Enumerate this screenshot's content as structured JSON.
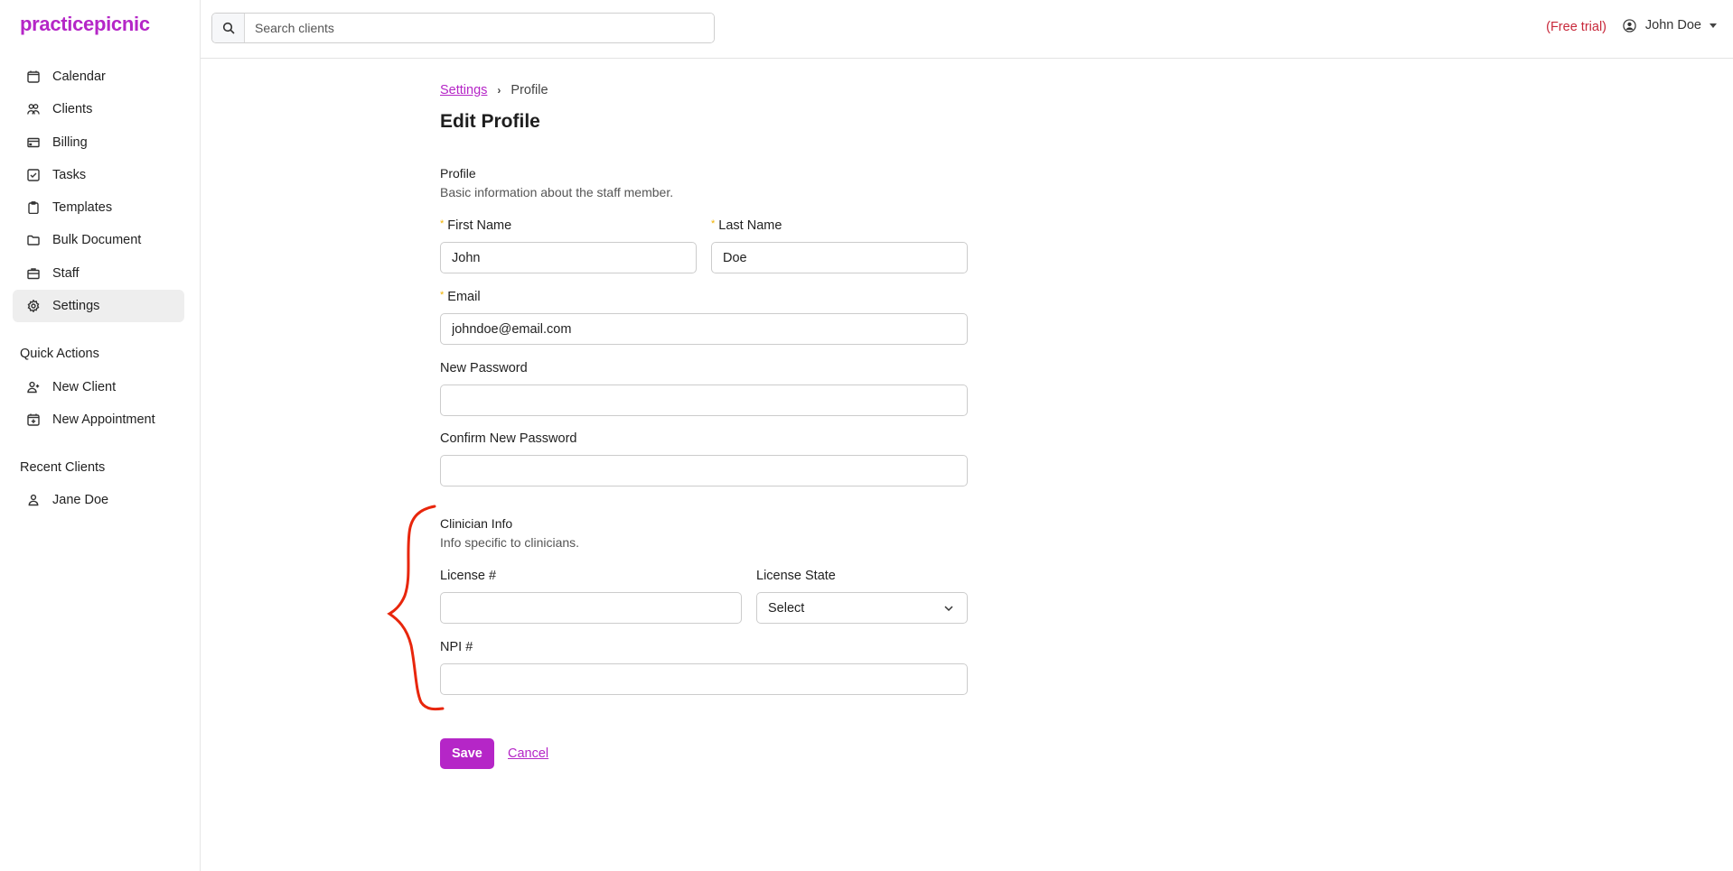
{
  "app": {
    "logo": "practicepicnic",
    "brand_color": "#b526c7"
  },
  "sidebar": {
    "nav": [
      {
        "label": "Calendar",
        "icon": "calendar-icon"
      },
      {
        "label": "Clients",
        "icon": "users-icon"
      },
      {
        "label": "Billing",
        "icon": "credit-card-icon"
      },
      {
        "label": "Tasks",
        "icon": "checkbox-icon"
      },
      {
        "label": "Templates",
        "icon": "clipboard-icon"
      },
      {
        "label": "Bulk Document",
        "icon": "folder-icon"
      },
      {
        "label": "Staff",
        "icon": "briefcase-icon"
      },
      {
        "label": "Settings",
        "icon": "gear-icon",
        "active": true
      }
    ],
    "quick_actions_title": "Quick Actions",
    "quick_actions": [
      {
        "label": "New Client",
        "icon": "user-plus-icon"
      },
      {
        "label": "New Appointment",
        "icon": "calendar-plus-icon"
      }
    ],
    "recent_clients_title": "Recent Clients",
    "recent_clients": [
      {
        "label": "Jane Doe",
        "icon": "user-icon"
      }
    ]
  },
  "header": {
    "search_placeholder": "Search clients",
    "search_value": "",
    "trial_label": "(Free trial)",
    "trial_color": "#c8283a",
    "user_name": "John Doe"
  },
  "main": {
    "breadcrumb": {
      "parent": "Settings",
      "separator": "›",
      "current": "Profile"
    },
    "title": "Edit Profile",
    "profile_section": {
      "heading": "Profile",
      "description": "Basic information about the staff member."
    },
    "fields": {
      "first_name": {
        "label": "First Name",
        "value": "John",
        "required": "*"
      },
      "last_name": {
        "label": "Last Name",
        "value": "Doe",
        "required": "*"
      },
      "email": {
        "label": "Email",
        "value": "johndoe@email.com",
        "required": "*"
      },
      "new_password": {
        "label": "New Password",
        "value": ""
      },
      "confirm_password": {
        "label": "Confirm New Password",
        "value": ""
      }
    },
    "clinician_section": {
      "heading": "Clinician Info",
      "description": "Info specific to clinicians."
    },
    "clinician_fields": {
      "license_number": {
        "label": "License #",
        "value": ""
      },
      "license_state": {
        "label": "License State",
        "value": "Select"
      },
      "npi_number": {
        "label": "NPI #",
        "value": ""
      }
    },
    "actions": {
      "save": "Save",
      "cancel": "Cancel"
    }
  },
  "annotation": {
    "type": "curly-brace",
    "color": "#e8260c",
    "marks": "clinician-info-section"
  }
}
